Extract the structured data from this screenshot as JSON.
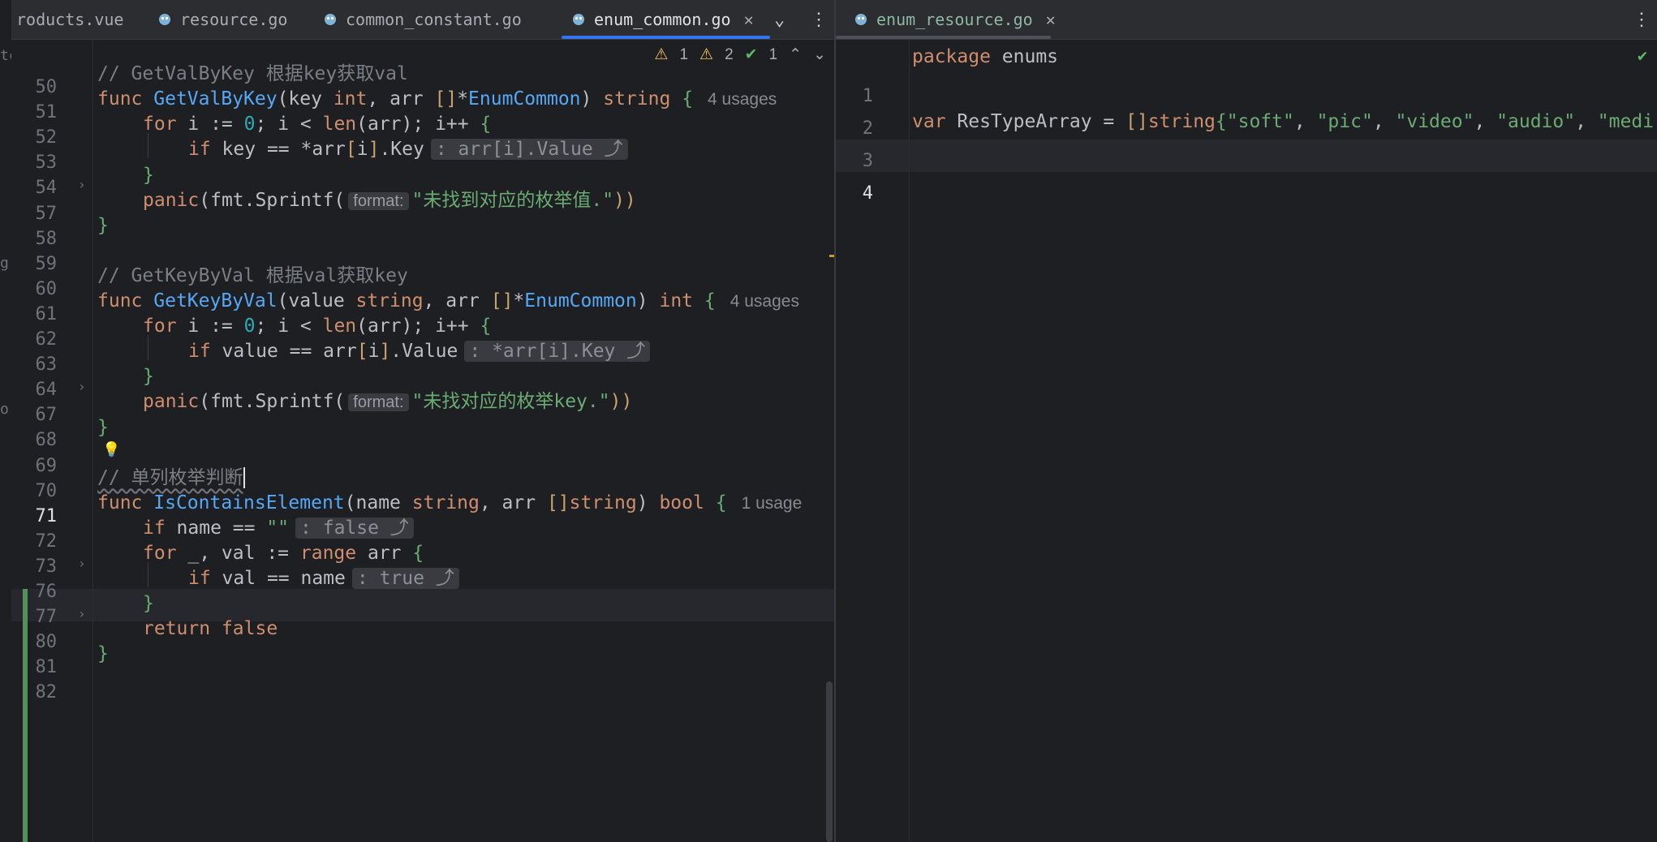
{
  "left_tabs": [
    {
      "label": "roducts.vue"
    },
    {
      "label": "resource.go"
    },
    {
      "label": "common_constant.go"
    },
    {
      "label": "enum_common.go",
      "active": true
    }
  ],
  "right_tabs": [
    {
      "label": "enum_resource.go",
      "active": true
    }
  ],
  "inspections": {
    "warnings_a": "1",
    "warnings_b": "2",
    "checks": "1"
  },
  "left_code": [
    {
      "ln": "50"
    },
    {
      "ln": "51",
      "comment": "// GetValByKey 根据key获取val"
    },
    {
      "ln": "52",
      "func_kw": "func",
      "name": "GetValByKey",
      "params": "(key int, arr []*EnumCommon) string {",
      "usages": "4 usages"
    },
    {
      "ln": "53",
      "text": "for i := 0; i < len(arr); i++ {"
    },
    {
      "ln": "54",
      "text": "if key == *arr[i].Key",
      "hint": ": arr[i].Value ⤴"
    },
    {
      "ln": "57",
      "text": "}"
    },
    {
      "ln": "58",
      "call": "panic(fmt.Sprintf(",
      "inlay": "format:",
      "str": "\"未找到对应的枚举值.\"",
      "tail": "))"
    },
    {
      "ln": "59",
      "text": "}"
    },
    {
      "ln": "60"
    },
    {
      "ln": "61",
      "comment": "// GetKeyByVal 根据val获取key"
    },
    {
      "ln": "62",
      "func_kw": "func",
      "name": "GetKeyByVal",
      "params": "(value string, arr []*EnumCommon) int {",
      "usages": "4 usages"
    },
    {
      "ln": "63",
      "text": "for i := 0; i < len(arr); i++ {"
    },
    {
      "ln": "64",
      "text": "if value == arr[i].Value",
      "hint": ": *arr[i].Key ⤴"
    },
    {
      "ln": "67",
      "text": "}"
    },
    {
      "ln": "68",
      "call": "panic(fmt.Sprintf(",
      "inlay": "format:",
      "str": "\"未找对应的枚举key.\"",
      "tail": "))"
    },
    {
      "ln": "69",
      "text": "}"
    },
    {
      "ln": "70"
    },
    {
      "ln": "71",
      "comment": "// 单列枚举判断"
    },
    {
      "ln": "72",
      "func_kw": "func",
      "name": "IsContainsElement",
      "params": "(name string, arr []string) bool {",
      "usages": "1 usage"
    },
    {
      "ln": "73",
      "text": "if name == \"\"",
      "hint": ": false ⤴"
    },
    {
      "ln": "76",
      "text": "for _, val := range arr {"
    },
    {
      "ln": "77",
      "text": "if val == name",
      "hint": ": true ⤴"
    },
    {
      "ln": "80",
      "text": "}"
    },
    {
      "ln": "81",
      "text": "return false"
    },
    {
      "ln": "82",
      "text": "}"
    }
  ],
  "right_code": [
    {
      "ln": "1",
      "kw": "package",
      "rest": " enums"
    },
    {
      "ln": "2"
    },
    {
      "ln": "3",
      "kw": "var",
      "ident": " ResTypeArray = ",
      "br": "[]",
      "ty": "string",
      "lb": "{",
      "items": [
        "\"soft\"",
        "\"pic\"",
        "\"video\"",
        "\"audio\"",
        "\"medi"
      ]
    },
    {
      "ln": "4"
    }
  ],
  "left_strip_chars": [
    "tc",
    "g",
    "o"
  ],
  "colors": {
    "accent": "#3574f0",
    "vcs_modified": "#549159",
    "bg": "#1e1f22",
    "tabbar": "#2b2d30"
  }
}
